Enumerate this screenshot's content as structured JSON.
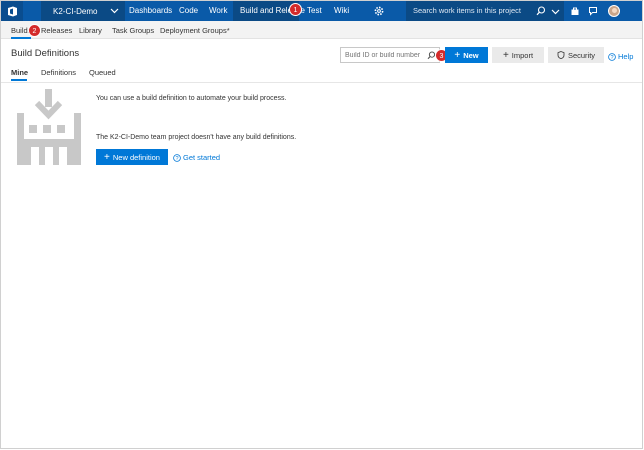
{
  "topbar": {
    "project": "K2-CI-Demo",
    "nav": [
      "Dashboards",
      "Code",
      "Work",
      "Build and Release",
      "Test",
      "Wiki"
    ],
    "search_placeholder": "Search work items in this project"
  },
  "subnav": [
    "Builds",
    "Releases",
    "Library",
    "Task Groups",
    "Deployment Groups*"
  ],
  "header": {
    "title": "Build Definitions",
    "search_placeholder": "Build ID or build number",
    "new_label": "New",
    "import_label": "Import",
    "security_label": "Security",
    "help_label": "Help"
  },
  "tabs": [
    "Mine",
    "Definitions",
    "Queued"
  ],
  "empty_state": {
    "line1": "You can use a build definition to automate your build process.",
    "line2": "The K2-CI-Demo team project doesn't have any build definitions.",
    "new_definition_label": "New definition",
    "get_started_label": "Get started"
  },
  "badges": [
    "1",
    "2",
    "3"
  ],
  "colors": {
    "topbar": "#0a5aa8",
    "accent": "#0078d7",
    "badge": "#d42b2b"
  }
}
